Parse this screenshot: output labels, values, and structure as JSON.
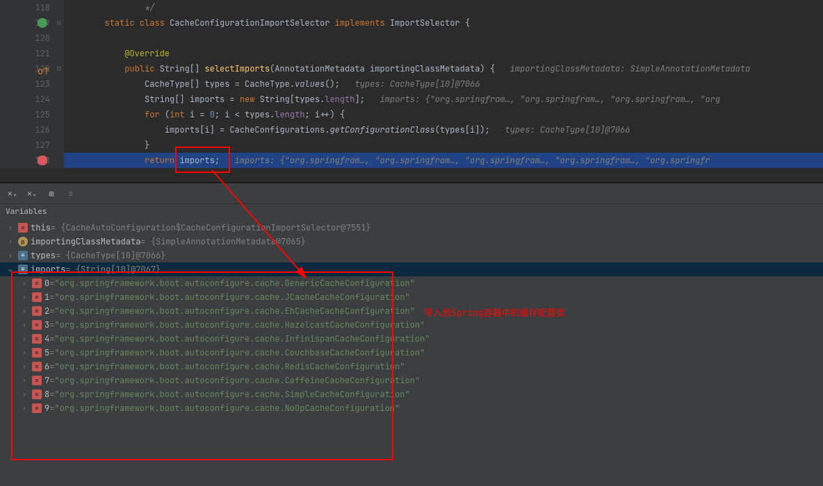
{
  "editor": {
    "lines": [
      {
        "num": "118",
        "indent": "               ",
        "tokens": [
          {
            "t": "*/",
            "c": "cmt"
          }
        ]
      },
      {
        "num": "119",
        "mark": "green",
        "fold": "⊟",
        "indent": "       ",
        "tokens": [
          {
            "t": "static class ",
            "c": "kw"
          },
          {
            "t": "CacheConfigurationImportSelector ",
            "c": "cls"
          },
          {
            "t": "implements ",
            "c": "kw"
          },
          {
            "t": "ImportSelector ",
            "c": "cls"
          },
          {
            "t": "{"
          }
        ]
      },
      {
        "num": "120"
      },
      {
        "num": "121",
        "indent": "           ",
        "tokens": [
          {
            "t": "@Override",
            "c": "ann"
          }
        ]
      },
      {
        "num": "122",
        "mark": "orange",
        "fold": "⊟",
        "indent": "           ",
        "tokens": [
          {
            "t": "public ",
            "c": "kw"
          },
          {
            "t": "String[] ",
            "c": "cls"
          },
          {
            "t": "selectImports",
            "c": "fn"
          },
          {
            "t": "(AnnotationMetadata importingClassMetadata) {   "
          },
          {
            "t": "importingClassMetadata: SimpleAnnotationMetadata",
            "c": "cmt"
          }
        ]
      },
      {
        "num": "123",
        "indent": "               ",
        "tokens": [
          {
            "t": "CacheType[] types = CacheType."
          },
          {
            "t": "values",
            "c": "ital"
          },
          {
            "t": "();   "
          },
          {
            "t": "types: CacheType[10]@7066",
            "c": "cmt"
          }
        ]
      },
      {
        "num": "124",
        "indent": "               ",
        "tokens": [
          {
            "t": "String[] imports = "
          },
          {
            "t": "new ",
            "c": "kw"
          },
          {
            "t": "String[types."
          },
          {
            "t": "length",
            "c": "field"
          },
          {
            "t": "];   "
          },
          {
            "t": "imports: {\"org.springfram…, \"org.springfram…, \"org.springfram…, \"org",
            "c": "cmt"
          }
        ]
      },
      {
        "num": "125",
        "indent": "               ",
        "tokens": [
          {
            "t": "for ",
            "c": "kw"
          },
          {
            "t": "("
          },
          {
            "t": "int ",
            "c": "kw"
          },
          {
            "t": "i = "
          },
          {
            "t": "0",
            "c": "num"
          },
          {
            "t": "; i < types."
          },
          {
            "t": "length",
            "c": "field"
          },
          {
            "t": "; i++) {"
          }
        ]
      },
      {
        "num": "126",
        "indent": "                   ",
        "tokens": [
          {
            "t": "imports[i] = CacheConfigurations."
          },
          {
            "t": "getConfigurationClass",
            "c": "ital"
          },
          {
            "t": "(types[i]);   "
          },
          {
            "t": "types: CacheType[10]@7066",
            "c": "cmt"
          }
        ]
      },
      {
        "num": "127",
        "indent": "               ",
        "tokens": [
          {
            "t": "}"
          }
        ]
      },
      {
        "num": "128",
        "mark": "bp",
        "hl": true,
        "indent": "               ",
        "tokens": [
          {
            "t": "return ",
            "c": "kw"
          },
          {
            "t": "imports;   "
          },
          {
            "t": "imports: {\"org.springfram…, \"org.springfram…, \"org.springfram…, \"org.springfram…, \"org.springfr",
            "c": "cmt"
          }
        ]
      }
    ]
  },
  "debug": {
    "header": "Variables",
    "vars": [
      {
        "exp": "›",
        "icon": "field",
        "iconLabel": "≡",
        "name": "this",
        "val": " = {CacheAutoConfiguration$CacheConfigurationImportSelector@7551}"
      },
      {
        "exp": "›",
        "icon": "param",
        "iconLabel": "p",
        "name": "importingClassMetadata",
        "val": " = {SimpleAnnotationMetadata@7065}"
      },
      {
        "exp": "›",
        "icon": "arr",
        "iconLabel": "≡",
        "name": "types",
        "val": " = {CacheType[10]@7066}"
      },
      {
        "exp": "⌄",
        "icon": "arr",
        "iconLabel": "≡",
        "name": "imports",
        "val": " = {String[10]@7067}",
        "sel": true
      }
    ],
    "arrayItems": [
      {
        "idx": "0",
        "val": "\"org.springframework.boot.autoconfigure.cache.GenericCacheConfiguration\""
      },
      {
        "idx": "1",
        "val": "\"org.springframework.boot.autoconfigure.cache.JCacheCacheConfiguration\""
      },
      {
        "idx": "2",
        "val": "\"org.springframework.boot.autoconfigure.cache.EhCacheCacheConfiguration\""
      },
      {
        "idx": "3",
        "val": "\"org.springframework.boot.autoconfigure.cache.HazelcastCacheConfiguration\""
      },
      {
        "idx": "4",
        "val": "\"org.springframework.boot.autoconfigure.cache.InfinispanCacheConfiguration\""
      },
      {
        "idx": "5",
        "val": "\"org.springframework.boot.autoconfigure.cache.CouchbaseCacheConfiguration\""
      },
      {
        "idx": "6",
        "val": "\"org.springframework.boot.autoconfigure.cache.RedisCacheConfiguration\""
      },
      {
        "idx": "7",
        "val": "\"org.springframework.boot.autoconfigure.cache.CaffeineCacheConfiguration\""
      },
      {
        "idx": "8",
        "val": "\"org.springframework.boot.autoconfigure.cache.SimpleCacheConfiguration\""
      },
      {
        "idx": "9",
        "val": "\"org.springframework.boot.autoconfigure.cache.NoOpCacheConfiguration\""
      }
    ]
  },
  "annotation": "导入到Spring容器中的缓存配置类"
}
